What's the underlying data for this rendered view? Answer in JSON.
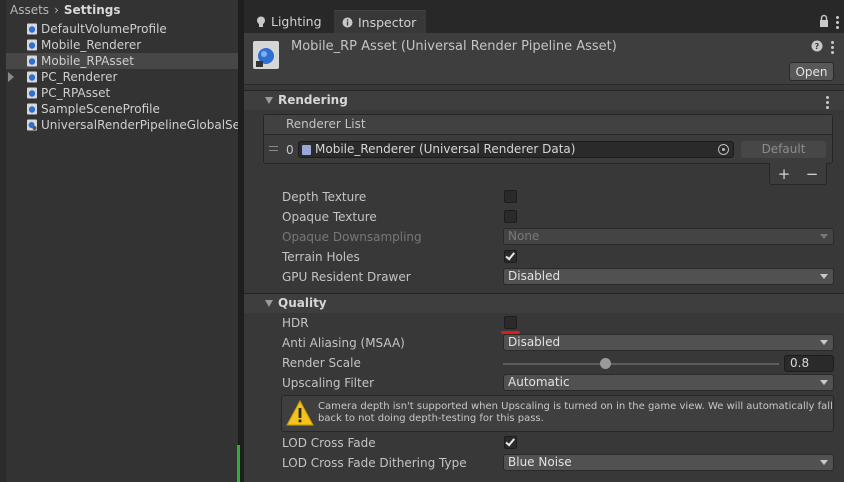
{
  "project": {
    "breadcrumb": [
      "Assets",
      "Settings"
    ],
    "breadcrumb_sep": "›",
    "assets": [
      {
        "label": "DefaultVolumeProfile",
        "icon": "volume-profile-icon",
        "selected": false,
        "foldout": false
      },
      {
        "label": "Mobile_Renderer",
        "icon": "renderer-data-icon",
        "selected": false,
        "foldout": false
      },
      {
        "label": "Mobile_RPAsset",
        "icon": "rp-asset-icon",
        "selected": true,
        "foldout": false
      },
      {
        "label": "PC_Renderer",
        "icon": "renderer-data-icon",
        "selected": false,
        "foldout": true
      },
      {
        "label": "PC_RPAsset",
        "icon": "rp-asset-icon",
        "selected": false,
        "foldout": false
      },
      {
        "label": "SampleSceneProfile",
        "icon": "volume-profile-icon",
        "selected": false,
        "foldout": false
      },
      {
        "label": "UniversalRenderPipelineGlobalSett",
        "icon": "global-settings-icon",
        "selected": false,
        "foldout": false
      }
    ]
  },
  "tabs": [
    {
      "label": "Lighting",
      "icon": "lightbulb-icon",
      "active": false
    },
    {
      "label": "Inspector",
      "icon": "info-icon",
      "active": true
    }
  ],
  "header": {
    "title": "Mobile_RP Asset (Universal Render Pipeline Asset)",
    "open_label": "Open"
  },
  "rendering": {
    "title": "Rendering",
    "renderer_list": {
      "header": "Renderer List",
      "items": [
        {
          "index": "0",
          "value": "Mobile_Renderer (Universal Renderer Data)",
          "default_label": "Default"
        }
      ],
      "add": "+",
      "remove": "−"
    },
    "depth_texture": {
      "label": "Depth Texture",
      "checked": false
    },
    "opaque_texture": {
      "label": "Opaque Texture",
      "checked": false
    },
    "opaque_downsampling": {
      "label": "Opaque Downsampling",
      "value": "None",
      "disabled": true
    },
    "terrain_holes": {
      "label": "Terrain Holes",
      "checked": true
    },
    "gpu_resident_drawer": {
      "label": "GPU Resident Drawer",
      "value": "Disabled"
    }
  },
  "quality": {
    "title": "Quality",
    "hdr": {
      "label": "HDR",
      "checked": false
    },
    "msaa": {
      "label": "Anti Aliasing (MSAA)",
      "value": "Disabled"
    },
    "render_scale": {
      "label": "Render Scale",
      "value": "0.8",
      "fraction": 0.8
    },
    "upscaling_filter": {
      "label": "Upscaling Filter",
      "value": "Automatic"
    },
    "warning": "Camera depth isn't supported when Upscaling is turned on in the game view. We will automatically fall back to not doing depth-testing for this pass.",
    "lod_cross_fade": {
      "label": "LOD Cross Fade",
      "checked": true
    },
    "lod_dither": {
      "label": "LOD Cross Fade Dithering Type",
      "value": "Blue Noise"
    }
  },
  "colors": {
    "accent_warning": "#f4c21b",
    "annotation_red": "#e01919",
    "selection": "#474747"
  }
}
